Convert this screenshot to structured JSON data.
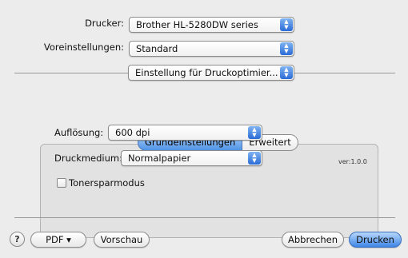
{
  "printer": {
    "label": "Drucker:",
    "value": "Brother HL-5280DW series"
  },
  "presets": {
    "label": "Voreinstellungen:",
    "value": "Standard"
  },
  "panel_selector": {
    "value": "Einstellung für Druckoptimier..."
  },
  "tabs": [
    {
      "label": "Grundeinstellungen",
      "active": true
    },
    {
      "label": "Erweitert",
      "active": false
    }
  ],
  "version": "ver:1.0.0",
  "resolution": {
    "label": "Auflösung:",
    "value": "600 dpi"
  },
  "media": {
    "label": "Druckmedium:",
    "value": "Normalpapier"
  },
  "toner_save": {
    "label": "Tonersparmodus",
    "checked": false
  },
  "footer": {
    "help": "?",
    "pdf": "PDF ▾",
    "preview": "Vorschau",
    "cancel": "Abbrechen",
    "print": "Drucken"
  },
  "colors": {
    "accent": "#3e86e6",
    "background": "#ececec"
  }
}
